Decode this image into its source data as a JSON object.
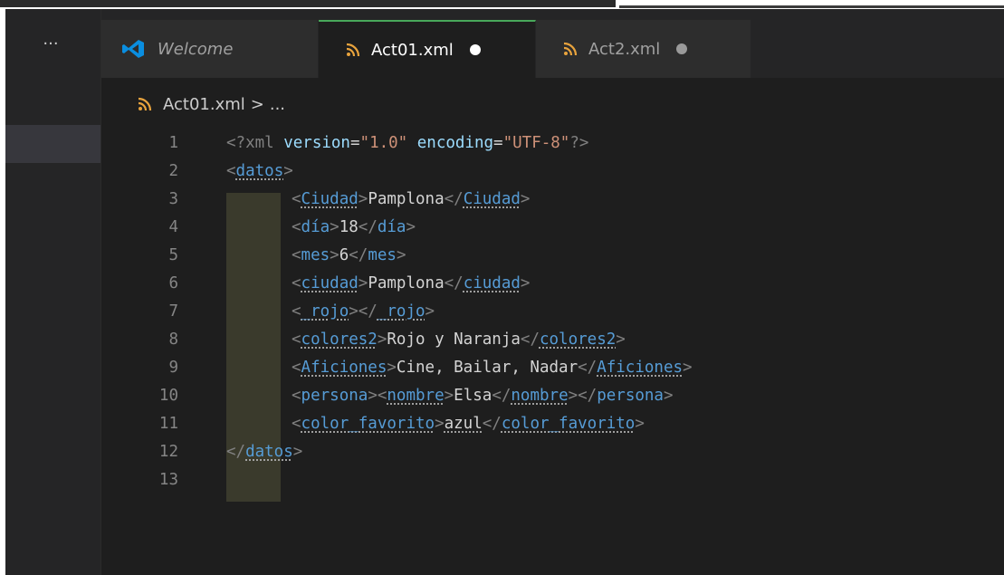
{
  "sidebar": {
    "more_label": "···"
  },
  "tabs": [
    {
      "label": "Welcome",
      "icon": "vscode-logo-icon",
      "active": false,
      "dirty": false
    },
    {
      "label": "Act01.xml",
      "icon": "rss-xml-icon",
      "active": true,
      "dirty": true
    },
    {
      "label": "Act2.xml",
      "icon": "rss-xml-icon",
      "active": false,
      "dirty": true
    }
  ],
  "breadcrumb": {
    "file": "Act01.xml",
    "separator": ">",
    "ellipsis": "..."
  },
  "editor": {
    "line_numbers": [
      "1",
      "2",
      "3",
      "4",
      "5",
      "6",
      "7",
      "8",
      "9",
      "10",
      "11",
      "12",
      "13"
    ],
    "decl": {
      "open": "<?xml ",
      "version_attr": "version",
      "eq": "=",
      "version_val": "\"1.0\"",
      "enc_attr": " encoding",
      "enc_val": "\"UTF-8\"",
      "close": "?>"
    },
    "datos_open": "datos",
    "datos_close": "datos",
    "rows": [
      {
        "tag": "Ciudad",
        "text": "Pamplona"
      },
      {
        "tag": "día",
        "text": "18"
      },
      {
        "tag": "mes",
        "text": "6"
      },
      {
        "tag": "ciudad",
        "text": "Pamplona"
      },
      {
        "tag": "_rojo",
        "text": ""
      },
      {
        "tag": "colores2",
        "text": "Rojo y Naranja"
      },
      {
        "tag": "Aficiones",
        "text": "Cine, Bailar, Nadar"
      },
      {
        "tag": "persona",
        "inner_tag": "nombre",
        "text": "Elsa"
      },
      {
        "tag": "color_favorito",
        "text": "azul"
      }
    ]
  },
  "colors": {
    "background": "#1e1e1e",
    "tag": "#569cd6",
    "attr": "#9cdcfe",
    "string": "#ce9178",
    "text": "#d4d4d4",
    "active_tab_border": "#48a85a"
  }
}
